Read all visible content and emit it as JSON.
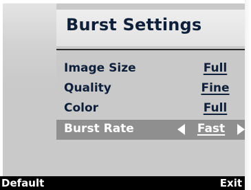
{
  "menu": {
    "title": "Burst Settings",
    "items": [
      {
        "label": "Image Size",
        "value": "Full",
        "selected": false
      },
      {
        "label": "Quality",
        "value": "Fine",
        "selected": false
      },
      {
        "label": "Color",
        "value": "Full",
        "selected": false
      },
      {
        "label": "Burst Rate",
        "value": "Fast",
        "selected": true
      }
    ]
  },
  "softkeys": {
    "left": "Default",
    "right": "Exit"
  },
  "colors": {
    "menu_background": "#c9c9c9",
    "text": "#0e1f3a",
    "selection": "#8f8f8f",
    "softkey_bar": "#000000"
  }
}
